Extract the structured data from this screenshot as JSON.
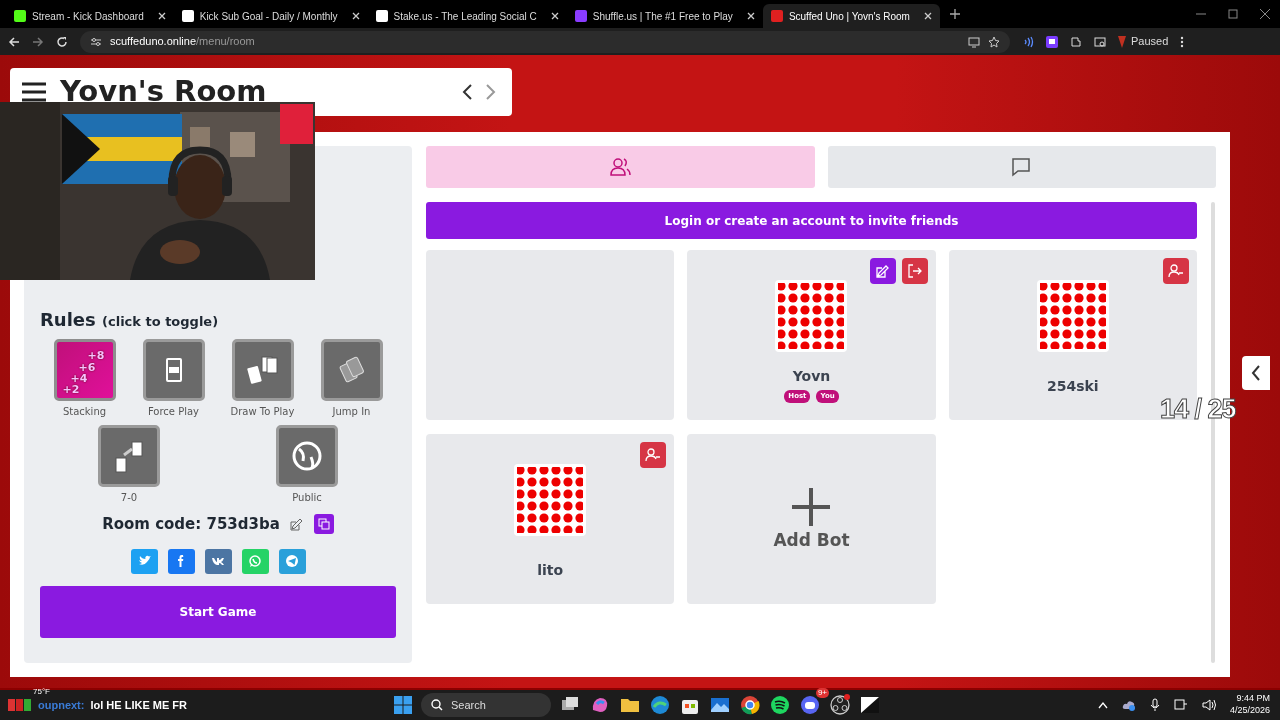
{
  "browser": {
    "tabs": [
      {
        "title": "Stream - Kick Dashboard",
        "kind": "kick",
        "selected": false
      },
      {
        "title": "Kick Sub Goal - Daily / Monthly",
        "kind": "grid",
        "selected": false
      },
      {
        "title": "Stake.us - The Leading Social C",
        "kind": "stake",
        "selected": false
      },
      {
        "title": "Shuffle.us | The #1 Free to Play",
        "kind": "shuffle",
        "selected": false
      },
      {
        "title": "Scuffed Uno | Yovn's Room",
        "kind": "uno",
        "selected": true
      }
    ],
    "url": {
      "domain": "scuffeduno.online",
      "path": "/menu/room"
    },
    "profile_status": "Paused"
  },
  "header": {
    "title": "Yovn's Room"
  },
  "rules": {
    "title": "Rules",
    "hint": "(click to toggle)",
    "items": [
      {
        "label": "Stacking",
        "kind": "stacking",
        "on": true,
        "icon_text": [
          "+2",
          "+4",
          "+6",
          "+8"
        ]
      },
      {
        "label": "Force Play",
        "kind": "force",
        "on": false
      },
      {
        "label": "Draw To Play",
        "kind": "draw",
        "on": false
      },
      {
        "label": "Jump In",
        "kind": "jump",
        "on": false
      },
      {
        "label": "7-0",
        "kind": "seven",
        "on": false
      },
      {
        "label": "Public",
        "kind": "public",
        "on": false
      }
    ]
  },
  "room_code": "Room code: 753d3ba",
  "share": [
    {
      "kind": "twitter",
      "color": "#1da1f2"
    },
    {
      "kind": "facebook",
      "color": "#1877f2"
    },
    {
      "kind": "vk",
      "color": "#4c75a3"
    },
    {
      "kind": "whatsapp",
      "color": "#25d366"
    },
    {
      "kind": "telegram",
      "color": "#2aa0da"
    }
  ],
  "start_button": "Start Game",
  "panel_tabs": [
    {
      "kind": "players",
      "selected": true
    },
    {
      "kind": "chat",
      "selected": false
    }
  ],
  "invite_banner": "Login or create an account to invite friends",
  "slots": [
    {
      "kind": "empty"
    },
    {
      "kind": "player",
      "name": "Yovn",
      "badges": [
        "Host",
        "You"
      ],
      "actions": [
        {
          "kind": "edit"
        },
        {
          "kind": "leave"
        }
      ]
    },
    {
      "kind": "player",
      "name": "254ski",
      "actions": [
        {
          "kind": "kick"
        }
      ]
    },
    {
      "kind": "player",
      "name": "lito",
      "actions": [
        {
          "kind": "kick"
        }
      ]
    },
    {
      "kind": "add",
      "label": "Add Bot"
    }
  ],
  "stream_overlay": {
    "counter": "14 / 25",
    "weather": "75°F",
    "chat_user": "oupnext:",
    "chat_message": "lol HE LIKE ME FR"
  },
  "taskbar": {
    "search": "Search",
    "apps": [
      {
        "kind": "taskview"
      },
      {
        "kind": "copilot"
      },
      {
        "kind": "folder"
      },
      {
        "kind": "edge"
      },
      {
        "kind": "store"
      },
      {
        "kind": "photos"
      },
      {
        "kind": "chrome"
      },
      {
        "kind": "spotify"
      },
      {
        "kind": "discord",
        "badge": "9+"
      },
      {
        "kind": "obs"
      },
      {
        "kind": "dc"
      }
    ],
    "time": "9:44 PM",
    "date": "4/25/2026"
  }
}
